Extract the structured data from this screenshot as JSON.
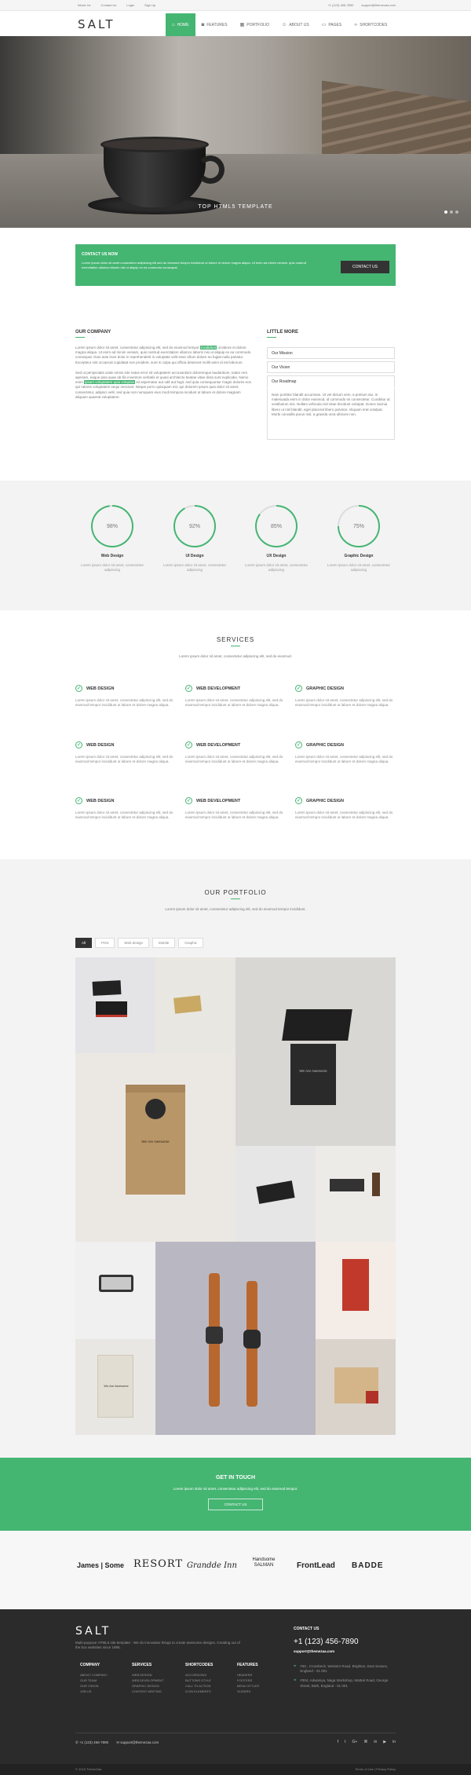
{
  "topbar": {
    "links": [
      "About Us",
      "Contact Us",
      "Login",
      "Sign Up"
    ],
    "phone": "+1 (123) 456-7890",
    "email": "support@themezaa.com"
  },
  "header": {
    "logo": "SALT",
    "nav": [
      {
        "label": "Home",
        "icon": "home-icon",
        "active": true
      },
      {
        "label": "Features",
        "icon": "camera-icon"
      },
      {
        "label": "Portfolio",
        "icon": "grid-icon"
      },
      {
        "label": "About Us",
        "icon": "user-icon"
      },
      {
        "label": "Pages",
        "icon": "file-icon"
      },
      {
        "label": "Shortcodes",
        "icon": "code-icon"
      }
    ]
  },
  "hero": {
    "caption": "Top HTML5 Template",
    "slides": 3,
    "active_slide": 1
  },
  "contact_bar": {
    "title": "Contact us now",
    "text": "Lorem ipsum dolor sit amet consectetur adipiscing elit sed do eiusmod tempor incididunt ut labore et dolore magna aliqua. Ut enim ad minim veniam, quis nostrud exercitation ullamco laboris nisi ut aliquip ex ea commodo consequat.",
    "button": "Contact us"
  },
  "company": {
    "title": "Our Company",
    "p1_a": "Lorem ipsum dolor sit amet, consectetur adipiscing elit, sed do eiusmod tempor",
    "p1_hl": "incididunt",
    "p1_b": "ut labore et dolore magna aliqua. Ut enim ad minim veniam, quis nostrud exercitation ullamco laboris nisi ut aliquip ex ea commodo consequat. Duis aute irure dolor in reprehenderit in voluptate velit esse cillum dolore eu fugiat nulla pariatur. Excepteur sint occaecat cupidatat non proident, sunt in culpa qui officia deserunt mollit anim id est laborum.",
    "p2_a": "Sed ut perspiciatis unde omnis iste natus error sit voluptatem accusantium doloremque laudantium, totam rem aperiam, eaque ipsa quae ab illo inventore veritatis et quasi architecto beatae vitae dicta sunt explicabo. Nemo enim",
    "p2_hl": "ipsam voluptatem quia voluptas",
    "p2_b": "sit aspernatur aut odit aut fugit, sed quia consequuntur magni dolores eos qui ratione voluptatem sequi nesciunt. Neque porro quisquam est, qui dolorem ipsum quia dolor sit amet, consectetur, adipisci velit, sed quia non numquam eius modi tempora incidunt ut labore et dolore magnam aliquam quaerat voluptatem."
  },
  "little_more": {
    "title": "Little More",
    "items": [
      "Our Mission",
      "Our Vision",
      "Our Roadmap"
    ],
    "body": "Nam porttitor blandit accumsan. Ut vel dictum sem, a pretium dui. In malesuada enim in dolor euismod, id commodo mi consectetur. Curabitur at vestibulum nisi. Nullam vehicula nisl vitae tincidunt volutpat. Donec lacinia libero ut nisl blandit, eget placerat libero pulvinar. Aliquam erat volutpat. Morbi convallis purus nisl, a gravida urna ultricies non."
  },
  "skills": [
    {
      "value": 98,
      "label": "98%",
      "name": "Web Design",
      "desc": "Lorem ipsum dolor sit amet, consectetur adipiscing"
    },
    {
      "value": 92,
      "label": "92%",
      "name": "UI Design",
      "desc": "Lorem ipsum dolor sit amet, consectetur adipiscing"
    },
    {
      "value": 85,
      "label": "85%",
      "name": "UX Design",
      "desc": "Lorem ipsum dolor sit amet, consectetur adipiscing"
    },
    {
      "value": 75,
      "label": "75%",
      "name": "Graphic Design",
      "desc": "Lorem ipsum dolor sit amet, consectetur adipiscing"
    }
  ],
  "services": {
    "title": "Services",
    "subtitle": "Lorem ipsum dolor sit amet, consectetur adipiscing elit, sed do eiusmod.",
    "desc": "Lorem ipsum dolor sit amet, consectetur adipiscing elit, sed do eiusmod tempor incididunt ut labore et dolore magna aliqua.",
    "rows": [
      [
        "Web Design",
        "Web Development",
        "Graphic Design"
      ],
      [
        "Web Design",
        "Web Development",
        "Graphic Design"
      ],
      [
        "Web Design",
        "Web Development",
        "Graphic Design"
      ]
    ]
  },
  "portfolio": {
    "title": "Our Portfolio",
    "subtitle": "Lorem ipsum dolor sit amet, consectetur adipiscing elit, sed do eiusmod tempor incididunt.",
    "filters": [
      "All",
      "Print",
      "Web design",
      "Mobile",
      "Graphic"
    ],
    "box_text": "We Are Awesome",
    "bag_text": "We Are Awesome",
    "tote_text": "We Are Awesome"
  },
  "touch": {
    "title": "Get in touch",
    "subtitle": "Lorem ipsum dolor sit amet, consectetur adipiscing elit, sed do eiusmod tempor.",
    "button": "Contact us"
  },
  "clients": [
    "James | Some",
    "RESORT",
    "Grandde Inn",
    "Handsome SALMAN",
    "FrontLead",
    "BADDE"
  ],
  "footer": {
    "logo": "SALT",
    "about": "Multi-purpose HTML5 site template - We do innovative things to create awesome designs. Creating out of the box websites since 1995.",
    "columns": [
      {
        "title": "Company",
        "items": [
          "About Company",
          "Our Team",
          "Our Vision",
          "Job Us"
        ]
      },
      {
        "title": "Services",
        "items": [
          "Web Design",
          "Web Development",
          "Graphic Design",
          "Content Writing"
        ]
      },
      {
        "title": "Shortcodes",
        "items": [
          "Accordions",
          "Buttons Style",
          "Call To Action",
          "Icon Elements"
        ]
      },
      {
        "title": "Features",
        "items": [
          "Headers",
          "Footers",
          "Menu Styles",
          "Sliders"
        ]
      }
    ],
    "contact_title": "Contact us",
    "contact_phone": "+1 (123) 456-7890",
    "contact_email": "support@themezaa.com",
    "address1": "#30 , Crossbeck, Western Road, Brighton, East Sussex, England - 01 001",
    "address2": "#304, Adwaniya, Naga Workshop, Mattuk Road, George Street, Bath, England - 01 001",
    "bottom_phone": "+1 (123) 456-7890",
    "bottom_email": "support@themezaa.com",
    "social": [
      "f",
      "t",
      "G+",
      "⌘",
      "in",
      "▶",
      "in"
    ],
    "copyright": "© 2016 ThemeZaa",
    "right_links": "Terms of Use  |  Privacy Policy"
  },
  "colors": {
    "accent": "#45b572",
    "dark": "#2b2b2b"
  }
}
